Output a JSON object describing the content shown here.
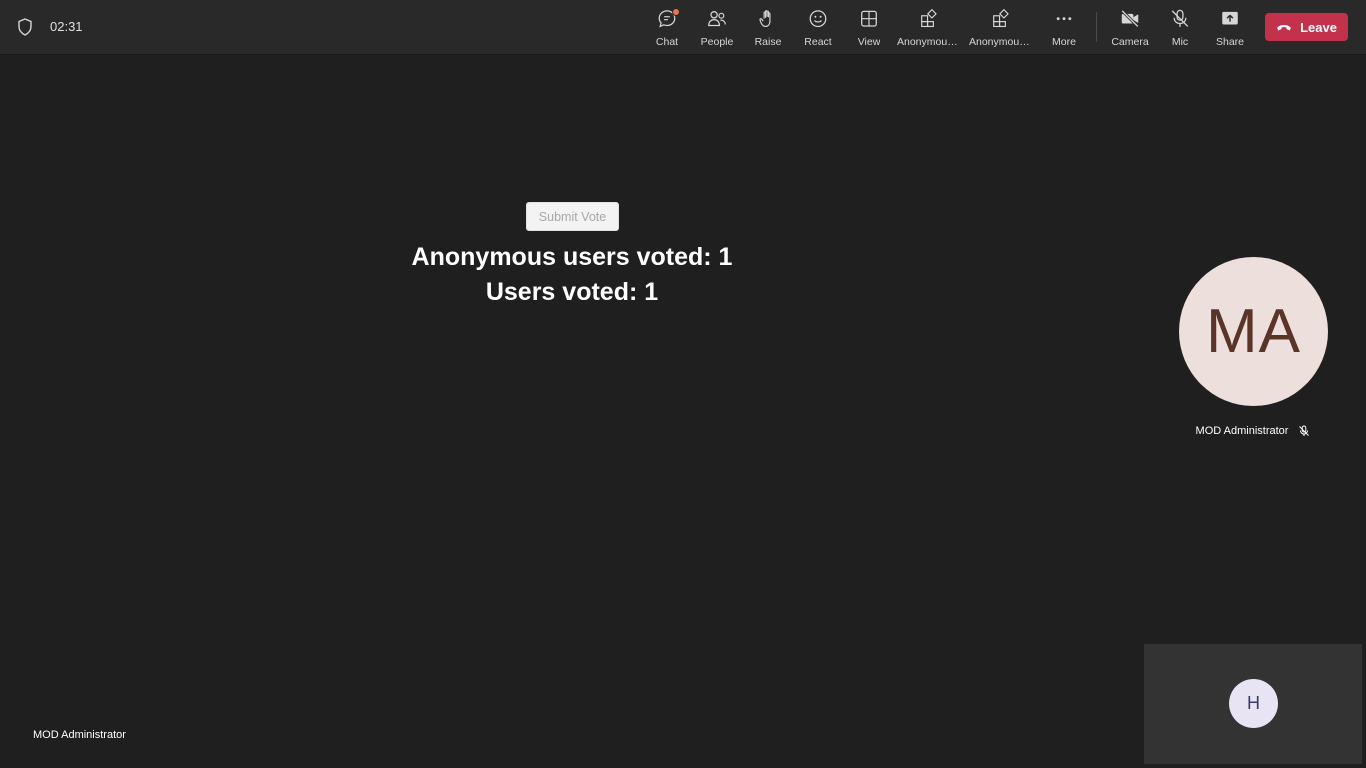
{
  "meeting": {
    "timer": "02:31"
  },
  "toolbar": {
    "chat": "Chat",
    "people": "People",
    "raise": "Raise",
    "react": "React",
    "view": "View",
    "app1": "Anonymous...",
    "app2": "Anonymous...",
    "more": "More",
    "camera": "Camera",
    "mic": "Mic",
    "share": "Share",
    "leave": "Leave"
  },
  "stage": {
    "submit_label": "Submit Vote",
    "anonymous_votes": "Anonymous users voted: 1",
    "user_votes": "Users voted: 1"
  },
  "participant": {
    "initials": "MA",
    "name": "MOD Administrator"
  },
  "footer": {
    "name": "MOD Administrator"
  },
  "self_view": {
    "initials": "H"
  },
  "colors": {
    "background": "#1f1f1f",
    "topbar": "#292929",
    "leave": "#c4314b",
    "notification": "#e97548"
  }
}
